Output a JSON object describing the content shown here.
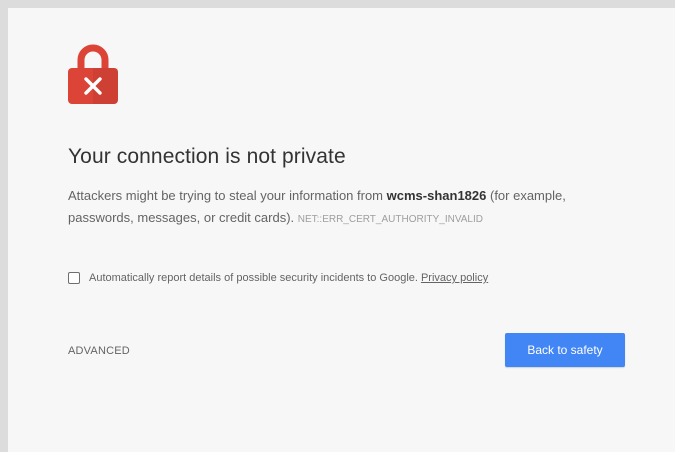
{
  "interstitial": {
    "title": "Your connection is not private",
    "message_before": "Attackers might be trying to steal your information from ",
    "hostname": "wcms-shan1826",
    "message_after": " (for example, passwords, messages, or credit cards). ",
    "error_code": "NET::ERR_CERT_AUTHORITY_INVALID",
    "report_label": "Automatically report details of possible security incidents to Google.",
    "privacy_link": "Privacy policy",
    "report_checked": false,
    "advanced_label": "ADVANCED",
    "safety_button_label": "Back to safety",
    "icon": "lock-error-icon"
  },
  "colors": {
    "page_background": "#f7f7f7",
    "frame_background": "#dcdcdc",
    "lock_red": "#db4437",
    "button_blue": "#4285f4",
    "title_text": "#333333",
    "body_text": "#646464"
  }
}
